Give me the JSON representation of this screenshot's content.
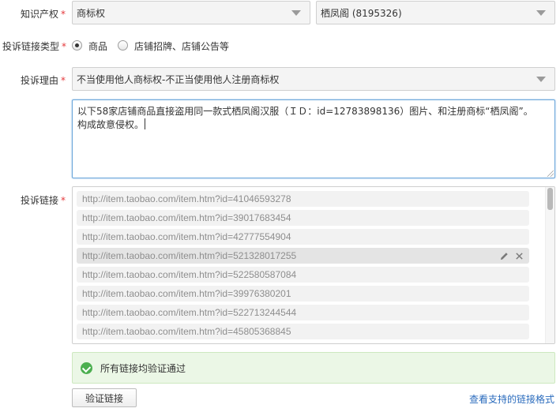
{
  "ip_row": {
    "label": "知识产权",
    "required_mark": "*",
    "type_select": "商标权",
    "owner_select": "栖凤阁 (8195326)"
  },
  "link_type_row": {
    "label": "投诉链接类型",
    "required_mark": "*",
    "options": [
      {
        "label": "商品",
        "checked": true
      },
      {
        "label": "店铺招牌、店铺公告等",
        "checked": false
      }
    ]
  },
  "reason_row": {
    "label": "投诉理由",
    "required_mark": "*",
    "select_value": "不当使用他人商标权-不正当使用他人注册商标权",
    "text_line1": "以下58家店铺商品直接盗用同一款式栖凤阁汉服（ＩＤ：id=12783898136）图片、和注册商标“栖凤阁”。",
    "text_line2": "构成故意侵权。"
  },
  "links_row": {
    "label": "投诉链接",
    "required_mark": "*",
    "items": [
      "http://item.taobao.com/item.htm?id=41046593278",
      "http://item.taobao.com/item.htm?id=39017683454",
      "http://item.taobao.com/item.htm?id=42777554904",
      "http://item.taobao.com/item.htm?id=521328017255",
      "http://item.taobao.com/item.htm?id=522580587084",
      "http://item.taobao.com/item.htm?id=39976380201",
      "http://item.taobao.com/item.htm?id=522713244544",
      "http://item.taobao.com/item.htm?id=45805368845"
    ],
    "hovered_index": 3
  },
  "validation": {
    "message": "所有链接均验证通过",
    "verify_button": "验证链接",
    "formats_link": "查看支持的链接格式"
  }
}
